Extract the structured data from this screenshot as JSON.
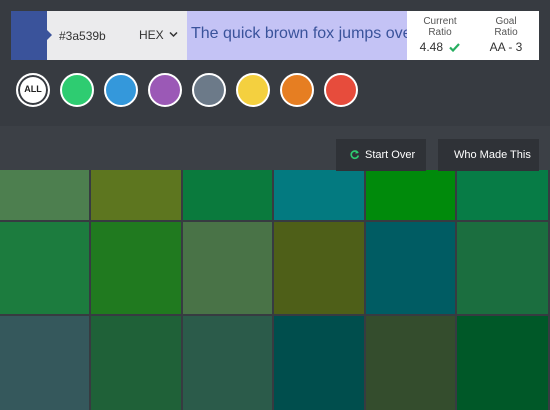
{
  "color_input": {
    "value": "#3a539b",
    "swatch_color": "#3a539b"
  },
  "format_select": {
    "selected": "HEX"
  },
  "preview": {
    "text": "The quick brown fox jumps over the lazy dog",
    "text_color": "#3a539b",
    "background": "#c4c3f5"
  },
  "ratio": {
    "current_label": "Current Ratio",
    "current_value": "4.48",
    "goal_label": "Goal Ratio",
    "goal_value": "AA - 3"
  },
  "filters": [
    {
      "name": "all",
      "label": "ALL",
      "color": "#ffffff"
    },
    {
      "name": "green",
      "color": "#2ecc71"
    },
    {
      "name": "blue",
      "color": "#3498db"
    },
    {
      "name": "purple",
      "color": "#9b59b6"
    },
    {
      "name": "gray",
      "color": "#6c7a89"
    },
    {
      "name": "yellow",
      "color": "#f4d03f"
    },
    {
      "name": "orange",
      "color": "#e67e22"
    },
    {
      "name": "red",
      "color": "#e74c3c"
    }
  ],
  "buttons": {
    "start_over": "Start Over",
    "who_made_this": "Who Made This"
  },
  "grid": {
    "header_colors": [
      "#3c4046",
      "#3c4046",
      "#3c4046",
      "#3c4046",
      "#3c4046",
      "#3c4046"
    ],
    "rows": [
      [
        "#4d7f4f",
        "#5d761f",
        "#0a7a3d",
        "#037a80",
        "#008a0b",
        "#077c46"
      ],
      [
        "#1c7c3e",
        "#207a1f",
        "#497347",
        "#4e5f18",
        "#005c63",
        "#1b6e3f"
      ],
      [
        "#35585c",
        "#1f6138",
        "#2b5b4a",
        "#004e4d",
        "#344d2d",
        "#005828"
      ]
    ]
  }
}
